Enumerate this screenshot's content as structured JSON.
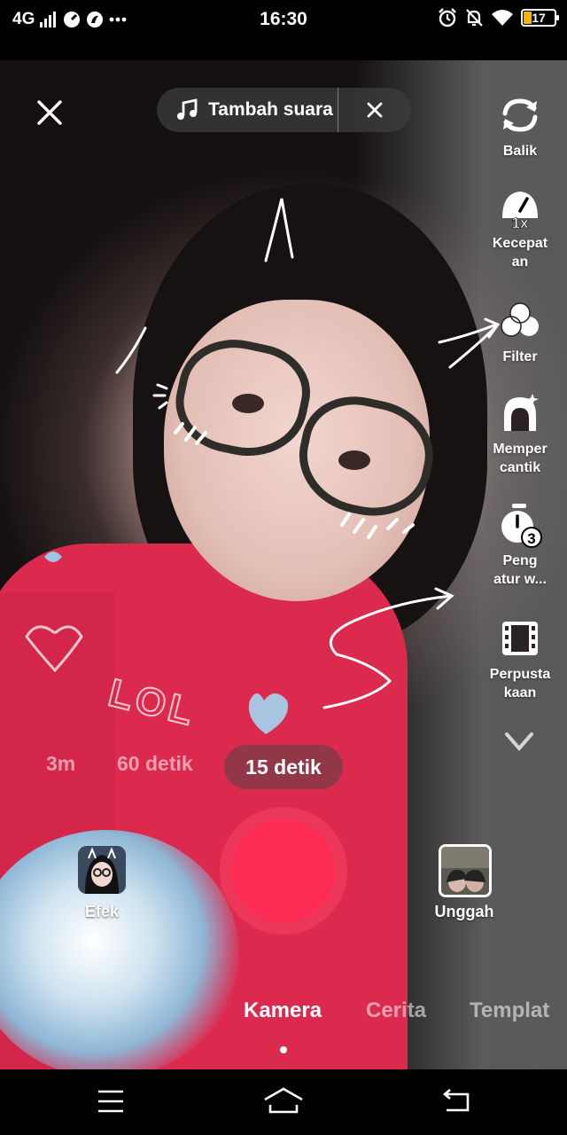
{
  "status_bar": {
    "network": "4G",
    "time": "16:30",
    "battery": "17",
    "battery_color": "#f4b400"
  },
  "top": {
    "sound_label": "Tambah suara"
  },
  "right_rail": {
    "balik": "Balik",
    "kecepatan_line1": "Kecepat",
    "kecepatan_line2": "an",
    "speed_value": "1x",
    "filter": "Filter",
    "mempercantik_line1": "Memper",
    "mempercantik_line2": "cantik",
    "timer_line1": "Peng",
    "timer_line2": "atur w...",
    "timer_value": "3",
    "library_line1": "Perpusta",
    "library_line2": "kaan"
  },
  "durations": {
    "d1": "3m",
    "d2": "60 detik",
    "d3": "15 detik",
    "selected": "15 detik"
  },
  "effects_label": "Efek",
  "upload_label": "Unggah",
  "modes": {
    "m1": "Kamera",
    "m2": "Cerita",
    "m3": "Templat",
    "selected": "Kamera"
  },
  "colors": {
    "record": "#fe2c55",
    "shirt": "#dc2a4f"
  },
  "icons": {
    "close": "close-icon",
    "music": "music-note-icon",
    "flip": "flip-camera-icon",
    "speed": "speed-gauge-icon",
    "filter": "filter-icon",
    "beauty": "beauty-icon",
    "timer": "timer-icon",
    "library": "film-library-icon",
    "collapse": "chevron-down-icon"
  }
}
